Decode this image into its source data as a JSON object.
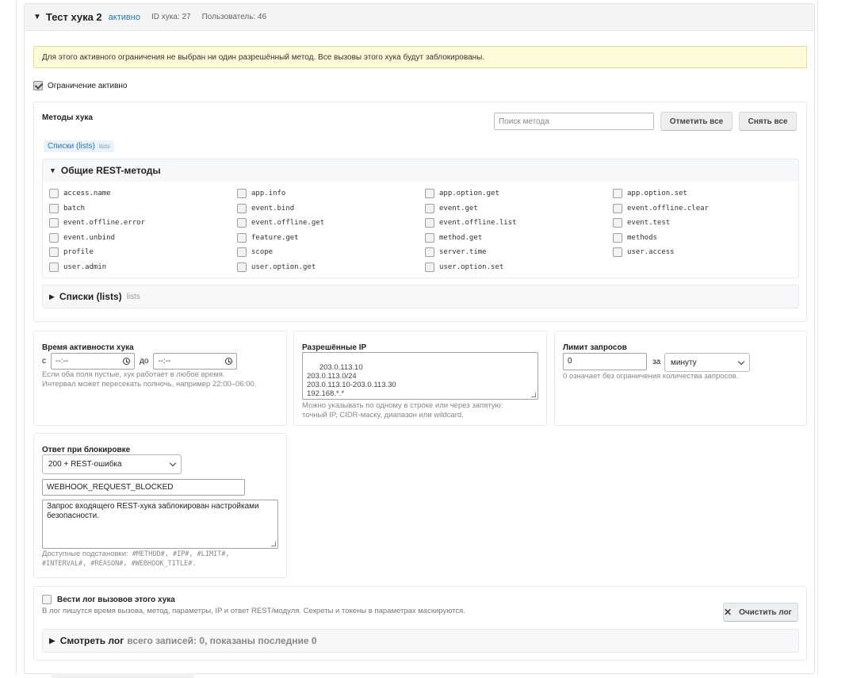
{
  "hook": {
    "title": "Тест хука 2",
    "status": "активно",
    "id_label": "ID хука: 27",
    "user_label": "Пользователь: 46"
  },
  "warning": "Для этого активного ограничения не выбран ни один разрешённый метод. Все вызовы этого хука будут заблокированы.",
  "restriction_active": {
    "label": "Ограничение активно",
    "checked": true
  },
  "methods": {
    "title": "Методы хука",
    "search_placeholder": "Поиск метода",
    "select_all": "Отметить все",
    "clear_all": "Снять все",
    "chip": {
      "label": "Списки (lists)",
      "sub": "lists"
    },
    "general_group": {
      "name": "Общие REST-методы",
      "items": [
        "access.name",
        "app.info",
        "app.option.get",
        "app.option.set",
        "batch",
        "event.bind",
        "event.get",
        "event.offline.clear",
        "event.offline.error",
        "event.offline.get",
        "event.offline.list",
        "event.test",
        "event.unbind",
        "feature.get",
        "method.get",
        "methods",
        "profile",
        "scope",
        "server.time",
        "user.access",
        "user.admin",
        "user.option.get",
        "user.option.set"
      ]
    },
    "lists_group": {
      "name": "Списки (lists)",
      "sub": "lists"
    }
  },
  "time": {
    "title": "Время активности хука",
    "from_label": "с",
    "to_label": "до",
    "from_value": "--:--",
    "to_value": "--:--",
    "hint1": "Если оба поля пустые, хук работает в любое время.",
    "hint2": "Интервал может пересекать полночь, например 22:00–06:00."
  },
  "ip": {
    "title": "Разрешённые IP",
    "value": "203.0.113.10\n203.0.113.0/24\n203.0.113.10-203.0.113.30\n192.168.*.*",
    "hint1": "Можно указывать по одному в строке или через запятую:",
    "hint2": "точный IP, CIDR-маску, диапазон или wildcard."
  },
  "limit": {
    "title": "Лимит запросов",
    "value": "0",
    "per_label": "за",
    "unit": "минуту",
    "hint": "0 означает без ограничения количества запросов."
  },
  "response": {
    "title": "Ответ при блокировке",
    "mode": "200 + REST-ошибка",
    "code": "WEBHOOK_REQUEST_BLOCKED",
    "message": "Запрос входящего REST-хука заблокирован настройками безопасности.",
    "hint_prefix": "Доступные подстановки:",
    "hint_vars1": "#METHOD#, #IP#, #LIMIT#,",
    "hint_vars2": "#INTERVAL#, #REASON#, #WEBHOOK_TITLE#."
  },
  "log": {
    "label": "Вести лог вызовов этого хука",
    "checked": false,
    "description": "В лог пишутся время вызова, метод, параметры, IP и ответ REST/модуля. Секреты и токены в параметрах маскируются.",
    "clear_button": "Очистить лог",
    "view_label": "Смотреть лог",
    "count_text": "всего записей: 0, показаны последние 0"
  }
}
